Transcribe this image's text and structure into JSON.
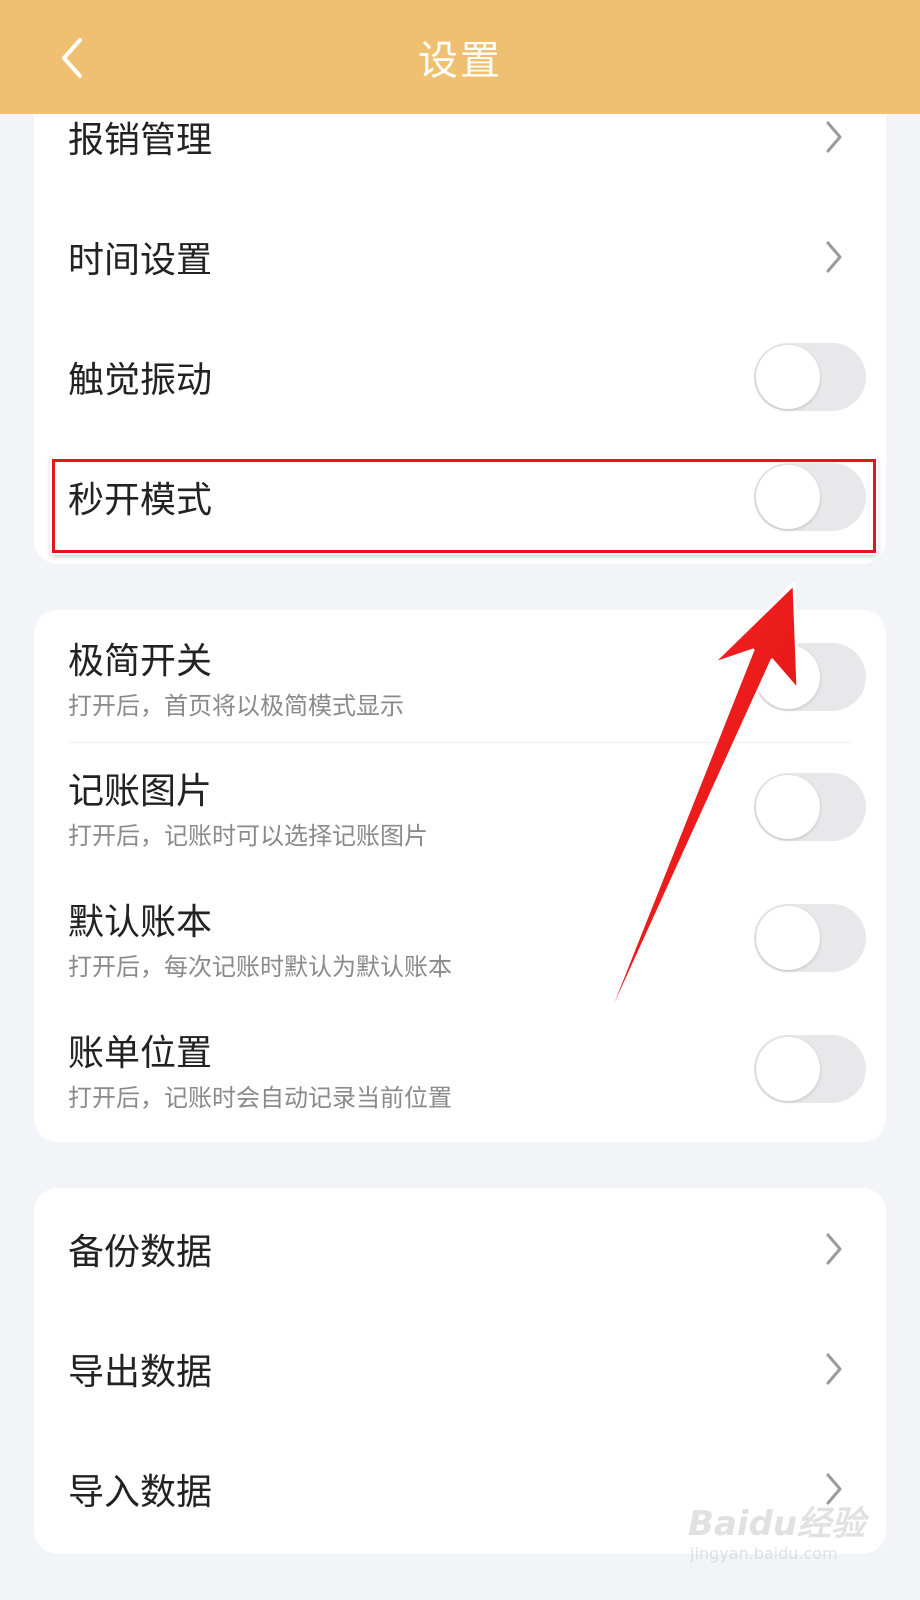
{
  "header": {
    "title": "设置",
    "back_icon": "chevron-left-icon"
  },
  "group1": {
    "items": [
      {
        "label": "报销管理",
        "type": "chevron"
      },
      {
        "label": "时间设置",
        "type": "chevron"
      },
      {
        "label": "触觉振动",
        "type": "toggle",
        "on": false
      },
      {
        "label": "秒开模式",
        "type": "toggle",
        "on": false,
        "highlighted": true
      }
    ]
  },
  "group2": {
    "items": [
      {
        "label": "极简开关",
        "subtitle": "打开后，首页将以极简模式显示",
        "on": false
      },
      {
        "label": "记账图片",
        "subtitle": "打开后，记账时可以选择记账图片",
        "on": false
      },
      {
        "label": "默认账本",
        "subtitle": "打开后，每次记账时默认为默认账本",
        "on": false
      },
      {
        "label": "账单位置",
        "subtitle": "打开后，记账时会自动记录当前位置",
        "on": false
      }
    ]
  },
  "group3": {
    "items": [
      {
        "label": "备份数据",
        "type": "chevron"
      },
      {
        "label": "导出数据",
        "type": "chevron"
      },
      {
        "label": "导入数据",
        "type": "chevron"
      }
    ]
  },
  "annotation": {
    "box_color": "#e8141c",
    "arrow_color": "#e8141c"
  },
  "watermark": {
    "logo": "Baidu经验",
    "url": "jingyan.baidu.com"
  },
  "colors": {
    "header_bg": "#efc071",
    "page_bg": "#f3f4f8",
    "card_bg": "#ffffff",
    "toggle_off": "#e8e8ea"
  }
}
